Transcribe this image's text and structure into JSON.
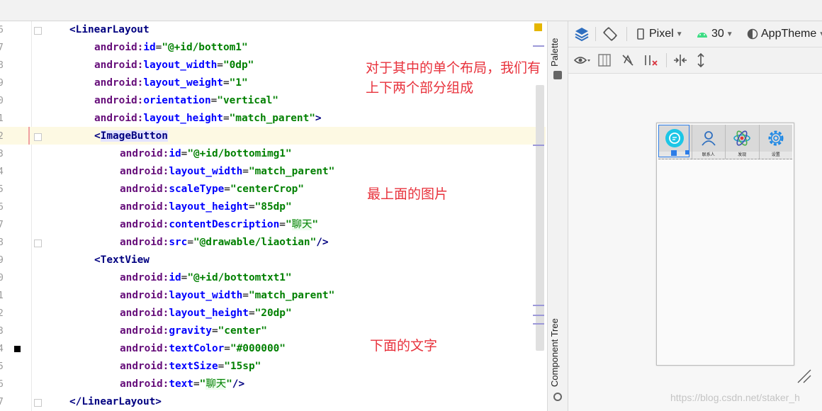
{
  "editor": {
    "lines": [
      {
        "n": "6",
        "tokens": [
          {
            "t": "<LinearLayout",
            "c": "tag"
          }
        ]
      },
      {
        "n": "7",
        "tokens": [
          {
            "t": "android:",
            "c": "attr-ns"
          },
          {
            "t": "id",
            "c": "attr"
          },
          {
            "t": "=",
            "c": "punc"
          },
          {
            "t": "\"@+id/bottom1\"",
            "c": "val"
          }
        ]
      },
      {
        "n": "8",
        "tokens": [
          {
            "t": "android:",
            "c": "attr-ns"
          },
          {
            "t": "layout_width",
            "c": "attr"
          },
          {
            "t": "=",
            "c": "punc"
          },
          {
            "t": "\"0dp\"",
            "c": "val"
          }
        ]
      },
      {
        "n": "9",
        "tokens": [
          {
            "t": "android:",
            "c": "attr-ns"
          },
          {
            "t": "layout_weight",
            "c": "attr"
          },
          {
            "t": "=",
            "c": "punc"
          },
          {
            "t": "\"1\"",
            "c": "val"
          }
        ]
      },
      {
        "n": "0",
        "tokens": [
          {
            "t": "android:",
            "c": "attr-ns"
          },
          {
            "t": "orientation",
            "c": "attr"
          },
          {
            "t": "=",
            "c": "punc"
          },
          {
            "t": "\"vertical\"",
            "c": "val"
          }
        ]
      },
      {
        "n": "1",
        "tokens": [
          {
            "t": "android:",
            "c": "attr-ns"
          },
          {
            "t": "layout_height",
            "c": "attr"
          },
          {
            "t": "=",
            "c": "punc"
          },
          {
            "t": "\"match_parent\"",
            "c": "val"
          },
          {
            "t": ">",
            "c": "tag"
          }
        ]
      },
      {
        "n": "2",
        "tokens": [
          {
            "t": "<",
            "c": "tag"
          },
          {
            "t": "ImageButton",
            "c": "tag tag-hl"
          }
        ]
      },
      {
        "n": "3",
        "tokens": [
          {
            "t": "android:",
            "c": "attr-ns"
          },
          {
            "t": "id",
            "c": "attr"
          },
          {
            "t": "=",
            "c": "punc"
          },
          {
            "t": "\"@+id/bottomimg1\"",
            "c": "val"
          }
        ]
      },
      {
        "n": "4",
        "tokens": [
          {
            "t": "android:",
            "c": "attr-ns"
          },
          {
            "t": "layout_width",
            "c": "attr"
          },
          {
            "t": "=",
            "c": "punc"
          },
          {
            "t": "\"match_parent\"",
            "c": "val"
          }
        ]
      },
      {
        "n": "5",
        "tokens": [
          {
            "t": "android:",
            "c": "attr-ns"
          },
          {
            "t": "scaleType",
            "c": "attr"
          },
          {
            "t": "=",
            "c": "punc"
          },
          {
            "t": "\"centerCrop\"",
            "c": "val"
          }
        ]
      },
      {
        "n": "6",
        "tokens": [
          {
            "t": "android:",
            "c": "attr-ns"
          },
          {
            "t": "layout_height",
            "c": "attr"
          },
          {
            "t": "=",
            "c": "punc"
          },
          {
            "t": "\"85dp\"",
            "c": "val"
          }
        ]
      },
      {
        "n": "7",
        "tokens": [
          {
            "t": "android:",
            "c": "attr-ns"
          },
          {
            "t": "contentDescription",
            "c": "attr"
          },
          {
            "t": "=",
            "c": "punc"
          },
          {
            "t": "\"",
            "c": "val"
          },
          {
            "t": "聊天",
            "c": "zh"
          },
          {
            "t": "\"",
            "c": "val"
          }
        ]
      },
      {
        "n": "8",
        "tokens": [
          {
            "t": "android:",
            "c": "attr-ns"
          },
          {
            "t": "src",
            "c": "attr"
          },
          {
            "t": "=",
            "c": "punc"
          },
          {
            "t": "\"@drawable/liaotian\"",
            "c": "val"
          },
          {
            "t": "/>",
            "c": "tag"
          }
        ]
      },
      {
        "n": "9",
        "tokens": [
          {
            "t": "<TextView",
            "c": "tag"
          }
        ]
      },
      {
        "n": "0",
        "tokens": [
          {
            "t": "android:",
            "c": "attr-ns"
          },
          {
            "t": "id",
            "c": "attr"
          },
          {
            "t": "=",
            "c": "punc"
          },
          {
            "t": "\"@+id/bottomtxt1\"",
            "c": "val"
          }
        ]
      },
      {
        "n": "1",
        "tokens": [
          {
            "t": "android:",
            "c": "attr-ns"
          },
          {
            "t": "layout_width",
            "c": "attr"
          },
          {
            "t": "=",
            "c": "punc"
          },
          {
            "t": "\"match_parent\"",
            "c": "val"
          }
        ]
      },
      {
        "n": "2",
        "tokens": [
          {
            "t": "android:",
            "c": "attr-ns"
          },
          {
            "t": "layout_height",
            "c": "attr"
          },
          {
            "t": "=",
            "c": "punc"
          },
          {
            "t": "\"20dp\"",
            "c": "val"
          }
        ]
      },
      {
        "n": "3",
        "tokens": [
          {
            "t": "android:",
            "c": "attr-ns"
          },
          {
            "t": "gravity",
            "c": "attr"
          },
          {
            "t": "=",
            "c": "punc"
          },
          {
            "t": "\"center\"",
            "c": "val"
          }
        ]
      },
      {
        "n": "4",
        "tokens": [
          {
            "t": "android:",
            "c": "attr-ns"
          },
          {
            "t": "textColor",
            "c": "attr"
          },
          {
            "t": "=",
            "c": "punc"
          },
          {
            "t": "\"#000000\"",
            "c": "val"
          }
        ]
      },
      {
        "n": "5",
        "tokens": [
          {
            "t": "android:",
            "c": "attr-ns"
          },
          {
            "t": "textSize",
            "c": "attr"
          },
          {
            "t": "=",
            "c": "punc"
          },
          {
            "t": "\"15sp\"",
            "c": "val"
          }
        ]
      },
      {
        "n": "6",
        "tokens": [
          {
            "t": "android:",
            "c": "attr-ns"
          },
          {
            "t": "text",
            "c": "attr"
          },
          {
            "t": "=",
            "c": "punc"
          },
          {
            "t": "\"",
            "c": "val"
          },
          {
            "t": "聊天",
            "c": "zh"
          },
          {
            "t": "\"",
            "c": "val"
          },
          {
            "t": "/>",
            "c": "tag"
          }
        ]
      },
      {
        "n": "7",
        "tokens": [
          {
            "t": "</LinearLayout>",
            "c": "tag"
          }
        ]
      }
    ]
  },
  "annotations": {
    "layout_note_line1": "对于其中的单个布局，我们有",
    "layout_note_line2": "上下两个部分组成",
    "image_note": "最上面的图片",
    "text_note": "下面的文字"
  },
  "side_tabs": {
    "palette": "Palette",
    "component_tree": "Component Tree"
  },
  "design_toolbar": {
    "device": "Pixel",
    "api": "30",
    "theme": "AppTheme"
  },
  "preview": {
    "tabs": [
      {
        "icon": "chat-icon",
        "label": ""
      },
      {
        "icon": "contacts-icon",
        "label": "联系人"
      },
      {
        "icon": "discover-icon",
        "label": "发现"
      },
      {
        "icon": "settings-icon",
        "label": "设置"
      }
    ]
  },
  "watermark": "https://blog.csdn.net/staker_h",
  "colors": {
    "annotation_red": "#e8323c",
    "selection_blue": "#2d7de8",
    "xml_tag": "#000080",
    "xml_attr": "#0000ff",
    "xml_value": "#008000"
  }
}
